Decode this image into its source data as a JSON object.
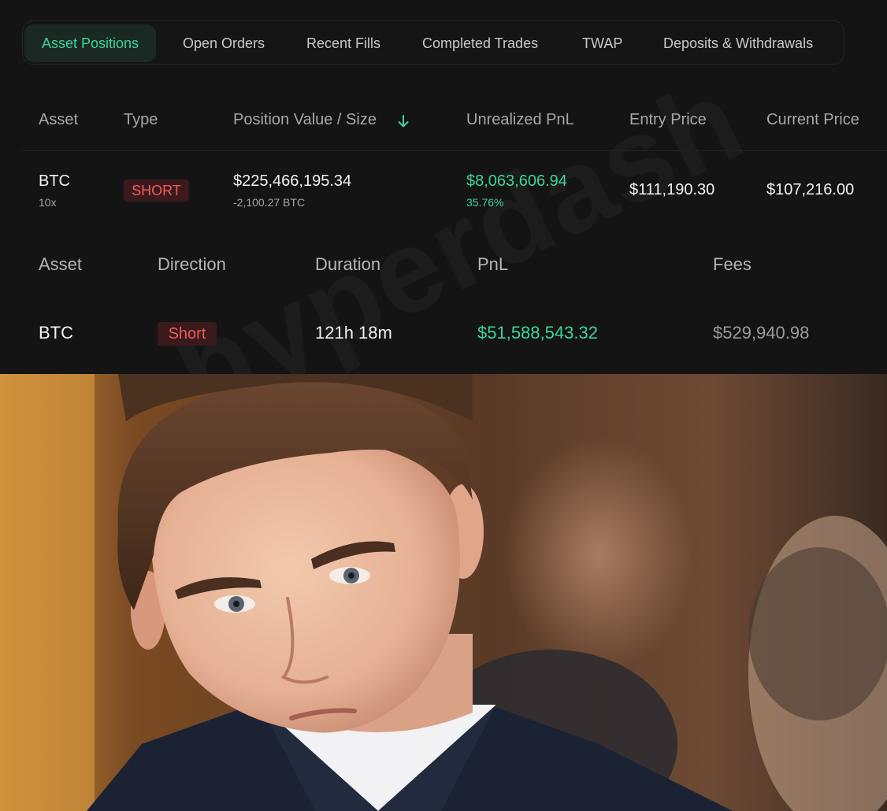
{
  "tabs": [
    {
      "label": "Asset Positions",
      "active": true
    },
    {
      "label": "Open Orders",
      "active": false
    },
    {
      "label": "Recent Fills",
      "active": false
    },
    {
      "label": "Completed Trades",
      "active": false
    },
    {
      "label": "TWAP",
      "active": false
    },
    {
      "label": "Deposits & Withdrawals",
      "active": false
    }
  ],
  "positions": {
    "headers": {
      "asset": "Asset",
      "type": "Type",
      "value_size": "Position Value / Size",
      "unrealized_pnl": "Unrealized PnL",
      "entry_price": "Entry Price",
      "current_price": "Current Price"
    },
    "row": {
      "asset": "BTC",
      "leverage": "10x",
      "type": "SHORT",
      "position_value": "$225,466,195.34",
      "size": "-2,100.27 BTC",
      "unrealized_pnl": "$8,063,606.94",
      "unrealized_pnl_pct": "35.76%",
      "entry_price": "$111,190.30",
      "current_price": "$107,216.00"
    }
  },
  "completed_trades": {
    "headers": {
      "asset": "Asset",
      "direction": "Direction",
      "duration": "Duration",
      "pnl": "PnL",
      "fees": "Fees"
    },
    "row": {
      "asset": "BTC",
      "direction": "Short",
      "duration": "121h 18m",
      "pnl": "$51,588,543.32",
      "fees": "$529,940.98"
    }
  },
  "watermark": "hyperdash",
  "icons": {
    "sort": "arrow-down-icon"
  },
  "colors": {
    "positive": "#3ed49a",
    "negative": "#ef5b5b",
    "background": "#141414"
  }
}
